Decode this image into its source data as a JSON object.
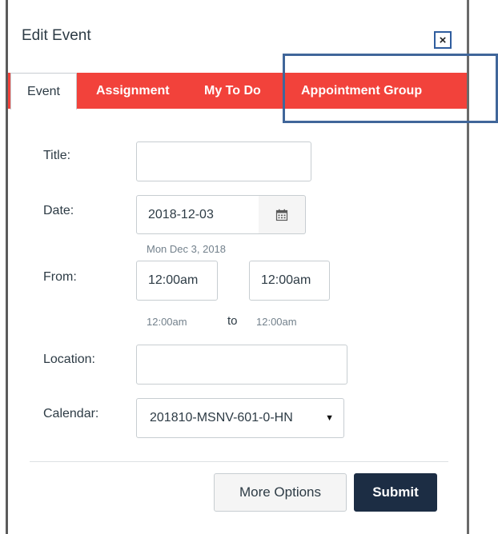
{
  "dialog": {
    "title": "Edit Event",
    "close_label": "×"
  },
  "tabs": [
    {
      "label": "Event",
      "active": true
    },
    {
      "label": "Assignment",
      "active": false
    },
    {
      "label": "My To Do",
      "active": false
    },
    {
      "label": "Appointment Group",
      "active": false
    }
  ],
  "form": {
    "title_label": "Title:",
    "title_value": "",
    "date_label": "Date:",
    "date_value": "2018-12-03",
    "date_hint": "Mon Dec 3, 2018",
    "from_label": "From:",
    "start_time": "12:00am",
    "end_time": "12:00am",
    "start_hint": "12:00am",
    "to_label": "to",
    "end_hint": "12:00am",
    "location_label": "Location:",
    "location_value": "",
    "calendar_label": "Calendar:",
    "calendar_value": "201810-MSNV-601-0-HN"
  },
  "buttons": {
    "more_options": "More Options",
    "submit": "Submit"
  },
  "colors": {
    "tab_bar": "#f2423b",
    "submit_bg": "#1c2d44",
    "highlight": "#40669a"
  }
}
